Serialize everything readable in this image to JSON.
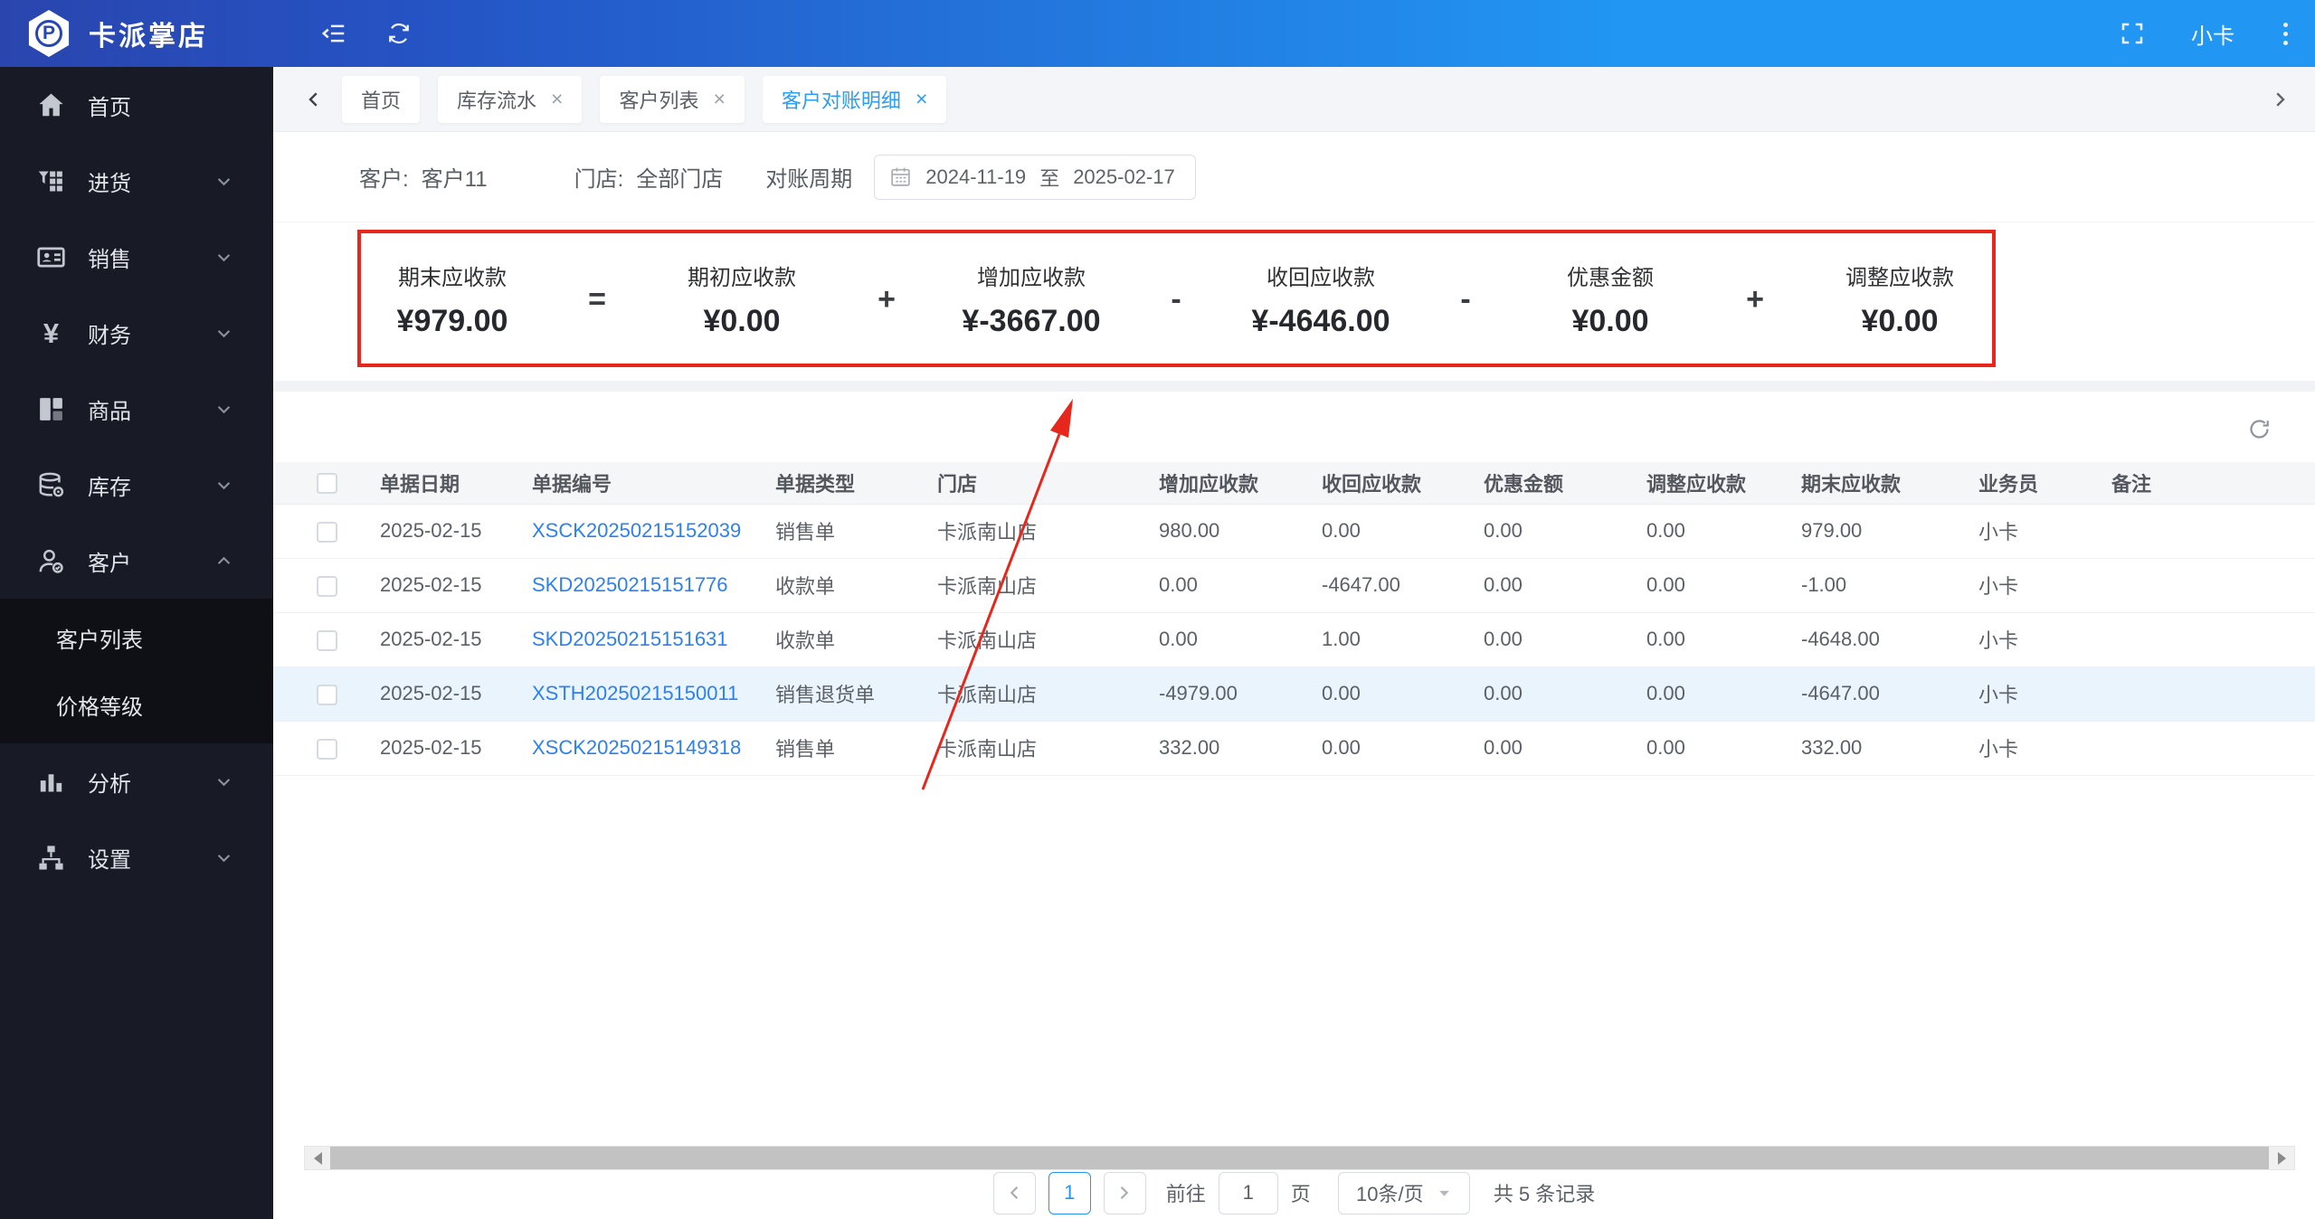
{
  "colors": {
    "accent": "#2196f3",
    "annotation_red": "#e8271c",
    "link_blue": "#2e80f0"
  },
  "topbar": {
    "app_title": "卡派掌店",
    "username": "小卡",
    "icons": [
      "menu-fold-icon",
      "refresh-icon",
      "fullscreen-icon",
      "kebab-menu-icon"
    ]
  },
  "sidebar": {
    "items": [
      {
        "id": "home",
        "label": "首页",
        "icon": "home-icon",
        "expandable": false
      },
      {
        "id": "purchase",
        "label": "进货",
        "icon": "purchase-icon",
        "expandable": true
      },
      {
        "id": "sales",
        "label": "销售",
        "icon": "sales-icon",
        "expandable": true
      },
      {
        "id": "finance",
        "label": "财务",
        "icon": "finance-icon",
        "expandable": true
      },
      {
        "id": "goods",
        "label": "商品",
        "icon": "goods-icon",
        "expandable": true
      },
      {
        "id": "inventory",
        "label": "库存",
        "icon": "inventory-icon",
        "expandable": true
      },
      {
        "id": "customer",
        "label": "客户",
        "icon": "customer-icon",
        "expandable": true,
        "expanded": true,
        "children": [
          {
            "id": "customer-list",
            "label": "客户列表"
          },
          {
            "id": "price-level",
            "label": "价格等级"
          }
        ]
      },
      {
        "id": "analysis",
        "label": "分析",
        "icon": "analysis-icon",
        "expandable": true
      },
      {
        "id": "settings",
        "label": "设置",
        "icon": "settings-icon",
        "expandable": true
      }
    ]
  },
  "tabbar": {
    "tabs": [
      {
        "id": "home",
        "label": "首页",
        "closable": false,
        "active": false
      },
      {
        "id": "inventory-flow",
        "label": "库存流水",
        "closable": true,
        "active": false
      },
      {
        "id": "customer-list",
        "label": "客户列表",
        "closable": true,
        "active": false
      },
      {
        "id": "customer-statement",
        "label": "客户对账明细",
        "closable": true,
        "active": true
      }
    ]
  },
  "filters": {
    "customer_label": "客户:",
    "customer_value": "客户11",
    "store_label": "门店:",
    "store_value": "全部门店",
    "period_label": "对账周期",
    "date_start": "2024-11-19",
    "date_separator": "至",
    "date_end": "2025-02-17"
  },
  "summary": {
    "stats": [
      {
        "label": "期末应收款",
        "value": "¥979.00"
      },
      {
        "label": "期初应收款",
        "value": "¥0.00"
      },
      {
        "label": "增加应收款",
        "value": "¥-3667.00"
      },
      {
        "label": "收回应收款",
        "value": "¥-4646.00"
      },
      {
        "label": "优惠金额",
        "value": "¥0.00"
      },
      {
        "label": "调整应收款",
        "value": "¥0.00"
      }
    ],
    "operators": [
      "=",
      "+",
      "-",
      "-",
      "+"
    ]
  },
  "table": {
    "columns": [
      "单据日期",
      "单据编号",
      "单据类型",
      "门店",
      "增加应收款",
      "收回应收款",
      "优惠金额",
      "调整应收款",
      "期末应收款",
      "业务员",
      "备注"
    ],
    "column_keys": [
      "date",
      "number",
      "type",
      "store",
      "add-receivable",
      "received",
      "discount",
      "adjust",
      "final-receivable",
      "salesman",
      "remark"
    ],
    "rows": [
      {
        "cells": [
          "2025-02-15",
          "XSCK20250215152039",
          "销售单",
          "卡派南山店",
          "980.00",
          "0.00",
          "0.00",
          "0.00",
          "979.00",
          "小卡",
          ""
        ],
        "highlighted": false
      },
      {
        "cells": [
          "2025-02-15",
          "SKD20250215151776",
          "收款单",
          "卡派南山店",
          "0.00",
          "-4647.00",
          "0.00",
          "0.00",
          "-1.00",
          "小卡",
          ""
        ],
        "highlighted": false
      },
      {
        "cells": [
          "2025-02-15",
          "SKD20250215151631",
          "收款单",
          "卡派南山店",
          "0.00",
          "1.00",
          "0.00",
          "0.00",
          "-4648.00",
          "小卡",
          ""
        ],
        "highlighted": false
      },
      {
        "cells": [
          "2025-02-15",
          "XSTH20250215150011",
          "销售退货单",
          "卡派南山店",
          "-4979.00",
          "0.00",
          "0.00",
          "0.00",
          "-4647.00",
          "小卡",
          ""
        ],
        "highlighted": true
      },
      {
        "cells": [
          "2025-02-15",
          "XSCK20250215149318",
          "销售单",
          "卡派南山店",
          "332.00",
          "0.00",
          "0.00",
          "0.00",
          "332.00",
          "小卡",
          ""
        ],
        "highlighted": false
      }
    ]
  },
  "pagination": {
    "current_page": "1",
    "goto_label": "前往",
    "goto_value": "1",
    "page_unit": "页",
    "page_size": "10条/页",
    "total_text": "共 5 条记录"
  }
}
